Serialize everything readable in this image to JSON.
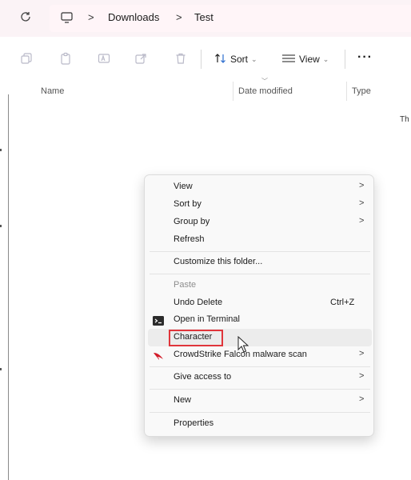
{
  "address_bar": {
    "crumbs": [
      "Downloads",
      "Test"
    ]
  },
  "toolbar": {
    "sort_label": "Sort",
    "view_label": "View",
    "more_label": "···"
  },
  "columns": {
    "name": "Name",
    "date_modified": "Date modified",
    "type": "Type"
  },
  "edge_text": "Th",
  "context_menu": {
    "items": [
      {
        "label": "View",
        "submenu": true
      },
      {
        "label": "Sort by",
        "submenu": true
      },
      {
        "label": "Group by",
        "submenu": true
      },
      {
        "label": "Refresh"
      },
      {
        "label": "Customize this folder..."
      },
      {
        "label": "Paste",
        "disabled": true
      },
      {
        "label": "Undo Delete",
        "shortcut": "Ctrl+Z"
      },
      {
        "label": "Open in Terminal",
        "icon": "terminal-icon"
      },
      {
        "label": "Character",
        "highlighted": true
      },
      {
        "label": "CrowdStrike Falcon malware scan",
        "icon": "crowdstrike-falcon-icon",
        "submenu": true
      },
      {
        "label": "Give access to",
        "submenu": true
      },
      {
        "label": "New",
        "submenu": true
      },
      {
        "label": "Properties"
      }
    ],
    "submenu_arrow": ">"
  },
  "colors": {
    "highlight_border": "#e0353b",
    "menu_background": "#f9f9f9",
    "address_bar_background": "#fbf3f6"
  }
}
